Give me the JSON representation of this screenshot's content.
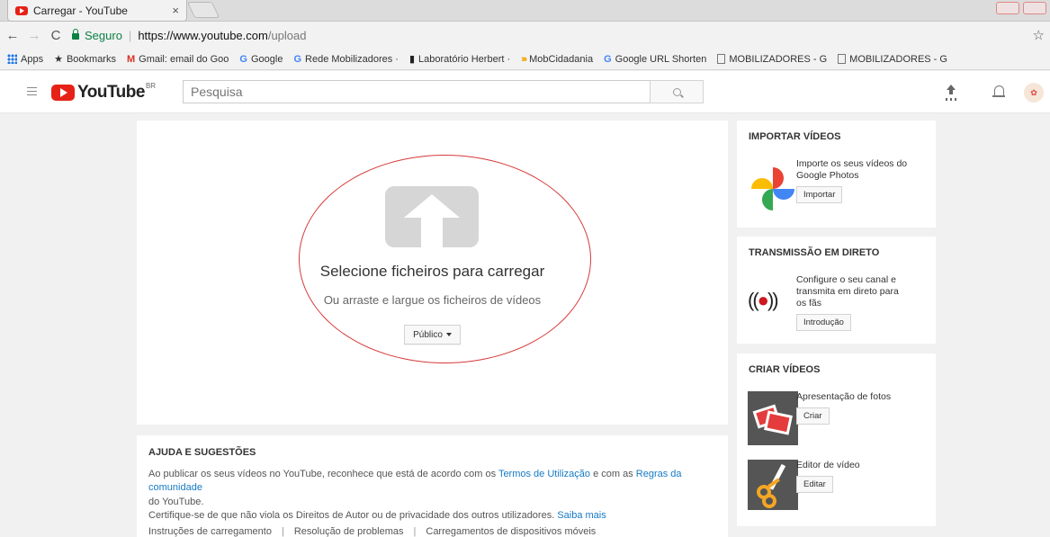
{
  "browser": {
    "tab_title": "Carregar - YouTube",
    "tab_close": "×",
    "secure_label": "Seguro",
    "url_host": "https://www.youtube.com",
    "url_path": "/upload"
  },
  "bookmarks": [
    {
      "label": "Apps"
    },
    {
      "label": "Bookmarks"
    },
    {
      "label": "Gmail: email do Goo"
    },
    {
      "label": "Google"
    },
    {
      "label": "Rede Mobilizadores ·"
    },
    {
      "label": "Laboratório Herbert ·"
    },
    {
      "label": "MobCidadania"
    },
    {
      "label": "Google URL Shorten"
    },
    {
      "label": "MOBILIZADORES - G"
    },
    {
      "label": "MOBILIZADORES - G"
    }
  ],
  "masthead": {
    "logo_text": "YouTube",
    "country": "BR",
    "search_placeholder": "Pesquisa"
  },
  "upload": {
    "title": "Selecione ficheiros para carregar",
    "subtitle": "Ou arraste e largue os ficheiros de vídeos",
    "privacy": "Público"
  },
  "help": {
    "heading": "AJUDA E SUGESTÕES",
    "line1_pre": "Ao publicar os seus vídeos no YouTube, reconhece que está de acordo com os ",
    "terms_link": "Termos de Utilização",
    "line1_mid": " e com as ",
    "rules_link": "Regras da comunidade",
    "line1_post": "do YouTube.",
    "line2": "Certifique-se de que não viola os Direitos de Autor ou de privacidade dos outros utilizadores.",
    "learn_more": "Saiba mais",
    "links": [
      "Instruções de carregamento",
      "Resolução de problemas",
      "Carregamentos de dispositivos móveis"
    ]
  },
  "import": {
    "heading": "IMPORTAR VÍDEOS",
    "text": "Importe os seus vídeos do Google Photos",
    "button": "Importar"
  },
  "live": {
    "heading": "TRANSMISSÃO EM DIRETO",
    "text": "Configure o seu canal e transmita em direto para os fãs",
    "button": "Introdução"
  },
  "create": {
    "heading": "CRIAR VÍDEOS",
    "photos_title": "Apresentação de fotos",
    "photos_button": "Criar",
    "editor_title": "Editor de vídeo",
    "editor_button": "Editar"
  },
  "colors": {
    "youtube_red": "#e62117",
    "link_blue": "#167ac6",
    "annotation_red": "#d73a3a",
    "secure_green": "#0b8043"
  }
}
